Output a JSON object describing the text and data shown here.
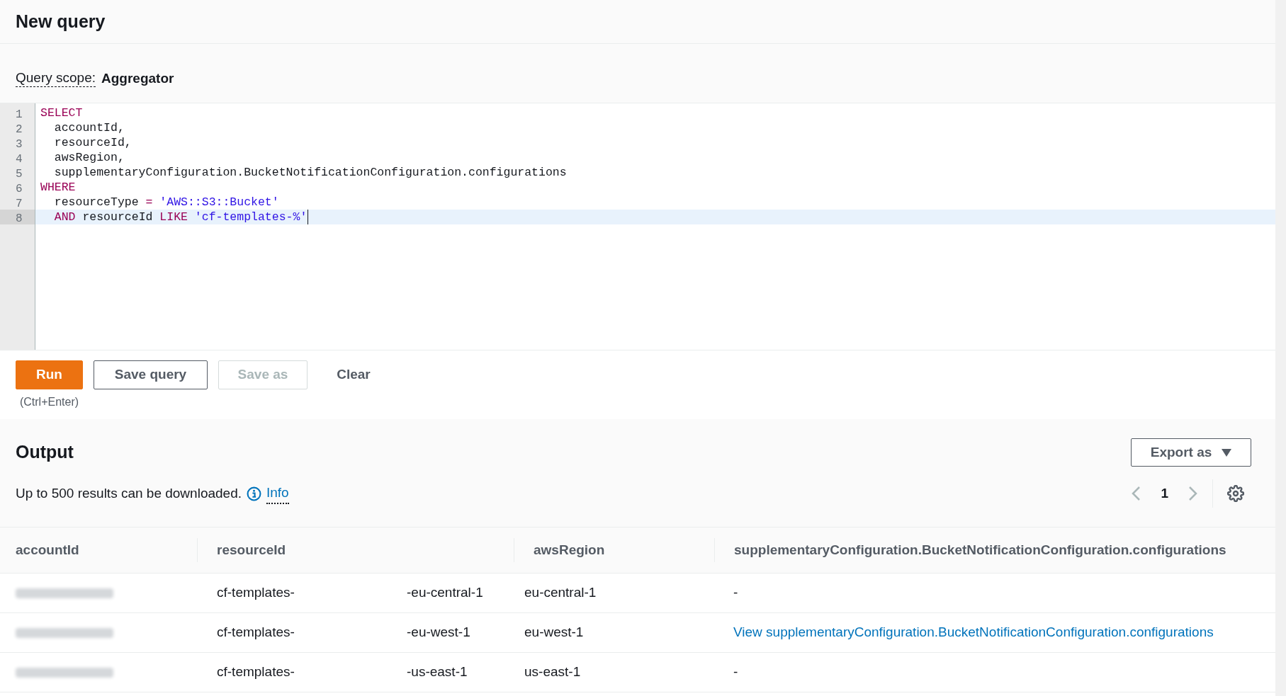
{
  "header": {
    "title": "New query"
  },
  "scope": {
    "label": "Query scope:",
    "value": "Aggregator"
  },
  "editor": {
    "lines": [
      {
        "number": "1",
        "active": false,
        "tokens": [
          {
            "kind": "keyword",
            "text": "SELECT"
          }
        ]
      },
      {
        "number": "2",
        "active": false,
        "tokens": [
          {
            "kind": "plain",
            "text": "  accountId,"
          }
        ]
      },
      {
        "number": "3",
        "active": false,
        "tokens": [
          {
            "kind": "plain",
            "text": "  resourceId,"
          }
        ]
      },
      {
        "number": "4",
        "active": false,
        "tokens": [
          {
            "kind": "plain",
            "text": "  awsRegion,"
          }
        ]
      },
      {
        "number": "5",
        "active": false,
        "tokens": [
          {
            "kind": "plain",
            "text": "  supplementaryConfiguration.BucketNotificationConfiguration.configurations"
          }
        ]
      },
      {
        "number": "6",
        "active": false,
        "tokens": [
          {
            "kind": "keyword",
            "text": "WHERE"
          }
        ]
      },
      {
        "number": "7",
        "active": false,
        "tokens": [
          {
            "kind": "plain",
            "text": "  resourceType "
          },
          {
            "kind": "keyword",
            "text": "="
          },
          {
            "kind": "string",
            "text": " 'AWS::S3::Bucket'"
          }
        ]
      },
      {
        "number": "8",
        "active": true,
        "tokens": [
          {
            "kind": "keyword",
            "text": "  AND"
          },
          {
            "kind": "plain",
            "text": " resourceId "
          },
          {
            "kind": "keyword",
            "text": "LIKE"
          },
          {
            "kind": "string",
            "text": " 'cf-templates-%'"
          }
        ]
      }
    ]
  },
  "actions": {
    "buttons": [
      {
        "kind": "primary",
        "label": "Run",
        "disabled": false
      },
      {
        "kind": "normal",
        "label": "Save query",
        "disabled": false
      },
      {
        "kind": "normal",
        "label": "Save as",
        "disabled": true
      },
      {
        "kind": "link",
        "label": "Clear",
        "disabled": false
      }
    ],
    "shortcut": "(Ctrl+Enter)"
  },
  "output": {
    "title": "Output",
    "export_button": "Export as",
    "note": "Up to 500 results can be downloaded.",
    "info_link": "Info",
    "page": "1"
  },
  "table": {
    "columns": [
      "accountId",
      "resourceId",
      "awsRegion",
      "supplementaryConfiguration.BucketNotificationConfiguration.configurations"
    ],
    "rows": [
      {
        "resource_prefix": "cf-templates-",
        "resource_suffix": "-eu-central-1",
        "region": "eu-central-1",
        "config": {
          "kind": "text",
          "text": "-"
        }
      },
      {
        "resource_prefix": "cf-templates-",
        "resource_suffix": "-eu-west-1",
        "region": "eu-west-1",
        "config": {
          "kind": "link",
          "text": "View supplementaryConfiguration.BucketNotificationConfiguration.configurations"
        }
      },
      {
        "resource_prefix": "cf-templates-",
        "resource_suffix": "-us-east-1",
        "region": "us-east-1",
        "config": {
          "kind": "text",
          "text": "-"
        }
      }
    ]
  }
}
